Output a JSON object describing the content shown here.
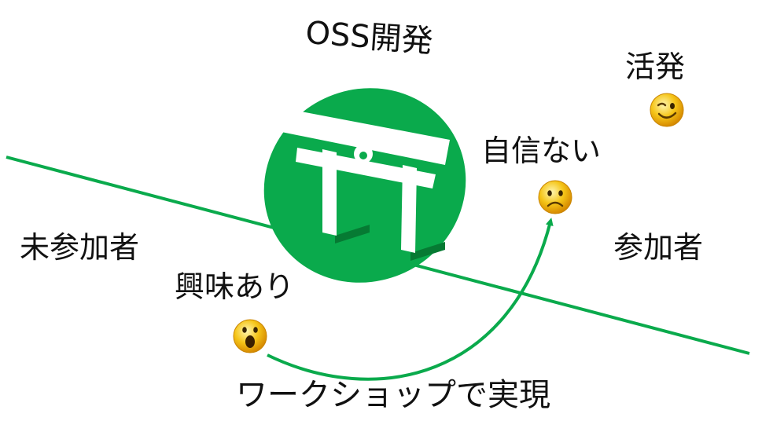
{
  "labels": {
    "oss": "OSS開発",
    "active": "活発",
    "not_confident": "自信ない",
    "non_participant": "未参加者",
    "participant": "参加者",
    "interested": "興味あり",
    "workshop": "ワークショップで実現"
  },
  "colors": {
    "green": "#0aaa4c",
    "torii": "#ffffff",
    "torii_shadow": "#067a33",
    "face": "#f2b90f",
    "text": "#111111"
  },
  "icons": [
    "torii-icon",
    "wink-face-icon",
    "sad-face-icon",
    "surprised-face-icon"
  ]
}
